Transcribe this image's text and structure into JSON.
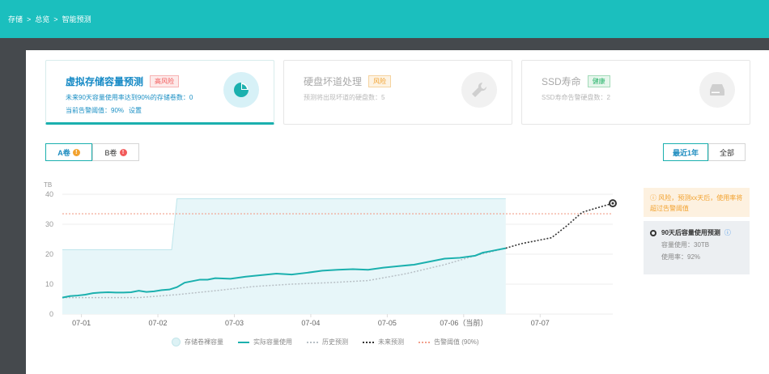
{
  "breadcrumb": {
    "items": [
      "存储",
      "总览",
      "智能预测"
    ],
    "separator": ">"
  },
  "cards": [
    {
      "title": "虚拟存储容量预测",
      "badge": "高风险",
      "line1": "未来90天容量使用率达到90%的存储卷数：0",
      "line2": "当前告警阈值：90%",
      "setting": "设置",
      "icon": "pie-chart-icon"
    },
    {
      "title": "硬盘坏道处理",
      "badge": "风险",
      "line1": "预测将出现坏道的硬盘数：5",
      "icon": "wrench-icon"
    },
    {
      "title": "SSD寿命",
      "badge": "健康",
      "line1": "SSD寿命告警硬盘数：2",
      "icon": "hard-drive-icon"
    }
  ],
  "volume_tabs": [
    {
      "label": "A卷",
      "flag": "!"
    },
    {
      "label": "B卷",
      "flag": "!"
    }
  ],
  "range_tabs": [
    "最近1年",
    "全部"
  ],
  "side": {
    "warning": "风险，预测xx天后，使用率将超过告警阈值",
    "prediction_title": "90天后容量使用预测",
    "capacity_used": "容量使用：30TB",
    "usage_rate": "使用率：92%"
  },
  "legend": [
    "存储卷裸容量",
    "实际容量使用",
    "历史预测",
    "未来预测",
    "告警阈值 (90%)"
  ],
  "colors": {
    "accent": "#1bb0ae",
    "topbar": "#1bbfbe",
    "alarm": "#f2a08c",
    "future": "#333333",
    "history": "#b8c0c6"
  },
  "chart_data": {
    "type": "line",
    "ylabel": "TB",
    "ylim": [
      0,
      40
    ],
    "yticks": [
      0,
      10,
      20,
      30,
      40
    ],
    "x_ticks": [
      "07-01",
      "07-02",
      "07-03",
      "07-04",
      "07-05",
      "07-06（当前）",
      "07-07"
    ],
    "threshold": 33.5,
    "series": [
      {
        "name": "存储卷裸容量",
        "x": [
          0,
          1.43,
          1.5,
          5.8
        ],
        "y": [
          21.5,
          21.5,
          38.5,
          38.5
        ]
      },
      {
        "name": "实际容量使用",
        "x": [
          0,
          0.1,
          0.2,
          0.3,
          0.4,
          0.5,
          0.6,
          0.7,
          0.8,
          0.9,
          1.0,
          1.1,
          1.2,
          1.3,
          1.4,
          1.5,
          1.6,
          1.7,
          1.8,
          1.9,
          2.0,
          2.2,
          2.4,
          2.6,
          2.8,
          3.0,
          3.2,
          3.4,
          3.6,
          3.8,
          4.0,
          4.2,
          4.4,
          4.6,
          4.8,
          5.0,
          5.2,
          5.4,
          5.5,
          5.6,
          5.7,
          5.8
        ],
        "y": [
          5.5,
          6,
          6.2,
          6.5,
          7,
          7.2,
          7.3,
          7.2,
          7.2,
          7.3,
          7.8,
          7.4,
          7.6,
          8,
          8.2,
          9,
          10.5,
          11,
          11.5,
          11.5,
          12,
          11.8,
          12.5,
          13,
          13.5,
          13.2,
          13.8,
          14.5,
          14.8,
          15,
          14.8,
          15.5,
          16,
          16.5,
          17.5,
          18.5,
          18.8,
          19.5,
          20.5,
          21,
          21.5,
          22
        ]
      },
      {
        "name": "历史预测",
        "x": [
          0,
          0.5,
          1.0,
          1.5,
          2.0,
          2.5,
          3.0,
          3.5,
          4.0,
          4.5,
          5.0,
          5.4,
          5.8
        ],
        "y": [
          5.5,
          5.5,
          5.5,
          6.5,
          7.8,
          9.2,
          10,
          10.5,
          11.2,
          13.5,
          16.5,
          19.5,
          22
        ]
      },
      {
        "name": "未来预测",
        "x": [
          5.8,
          6.0,
          6.2,
          6.4,
          6.6,
          6.8,
          7.0,
          7.2
        ],
        "y": [
          22,
          23.5,
          24.5,
          25.5,
          29.5,
          34,
          35.5,
          37
        ]
      }
    ]
  }
}
